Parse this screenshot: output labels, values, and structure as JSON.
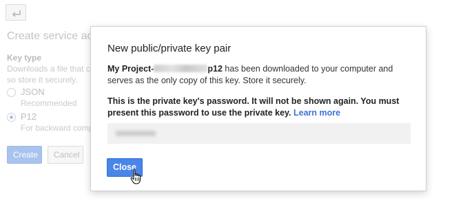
{
  "background": {
    "back_icon": "back-arrow-icon",
    "title": "Create service acco",
    "key_type_label": "Key type",
    "key_type_desc_line1": "Downloads a file that co",
    "key_type_desc_line2": "so store it securely.",
    "options": [
      {
        "label": "JSON",
        "sub": "Recommended",
        "checked": false
      },
      {
        "label": "P12",
        "sub": "For backward compa",
        "checked": true
      }
    ],
    "create_label": "Create",
    "cancel_label": "Cancel"
  },
  "modal": {
    "title": "New public/private key pair",
    "project_prefix": "My Project-",
    "project_suffix": "p12",
    "download_text": " has been downloaded to your computer and serves as the only copy of this key. Store it securely.",
    "password_notice": "This is the private key's password. It will not be shown again. You must present this password to use the private key. ",
    "learn_more": "Learn more",
    "close_label": "Close"
  },
  "icons": {
    "back": "back-arrow-icon",
    "cursor": "hand-pointer-icon"
  },
  "colors": {
    "primary_button": "#4a85e8",
    "link": "#3b73d9",
    "password_field_bg": "#f1f1f1"
  }
}
